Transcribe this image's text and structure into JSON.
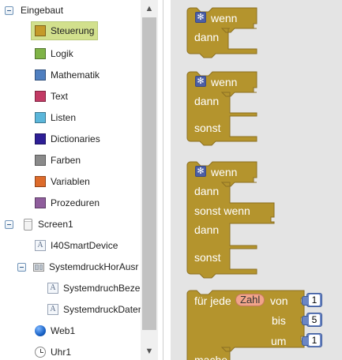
{
  "tree": {
    "builtin_label": "Eingebaut",
    "categories": [
      {
        "label": "Steuerung",
        "color": "#c49a2a",
        "selected": true
      },
      {
        "label": "Logik",
        "color": "#7fb347"
      },
      {
        "label": "Mathematik",
        "color": "#4f7fc0"
      },
      {
        "label": "Text",
        "color": "#c23a64"
      },
      {
        "label": "Listen",
        "color": "#5bb6da"
      },
      {
        "label": "Dictionaries",
        "color": "#2e1f96"
      },
      {
        "label": "Farben",
        "color": "#8a8a8a"
      },
      {
        "label": "Variablen",
        "color": "#dd6b2b"
      },
      {
        "label": "Prozeduren",
        "color": "#8f5d9c"
      }
    ],
    "screen_label": "Screen1",
    "components": {
      "i40": "I40SmartDevice",
      "arrangement": "SystemdruckHorAusr",
      "child1": "SystemdruchBezei",
      "child2": "SystemdruckDaten",
      "web": "Web1",
      "clock": "Uhr1"
    }
  },
  "scrollbar": {
    "up_icon": "chevron-up-icon",
    "down_icon": "chevron-down-icon"
  },
  "blocks": {
    "color": "#b4942d",
    "if1": {
      "wenn": "wenn",
      "dann": "dann"
    },
    "if2": {
      "wenn": "wenn",
      "dann": "dann",
      "sonst": "sonst"
    },
    "if3": {
      "wenn": "wenn",
      "dann1": "dann",
      "sonstwenn": "sonst wenn",
      "dann2": "dann",
      "sonst": "sonst"
    },
    "for": {
      "fuer_jede": "für jede",
      "var": "Zahl",
      "von": "von",
      "bis": "bis",
      "um": "um",
      "mache": "mache",
      "von_val": "1",
      "bis_val": "5",
      "um_val": "1"
    }
  }
}
